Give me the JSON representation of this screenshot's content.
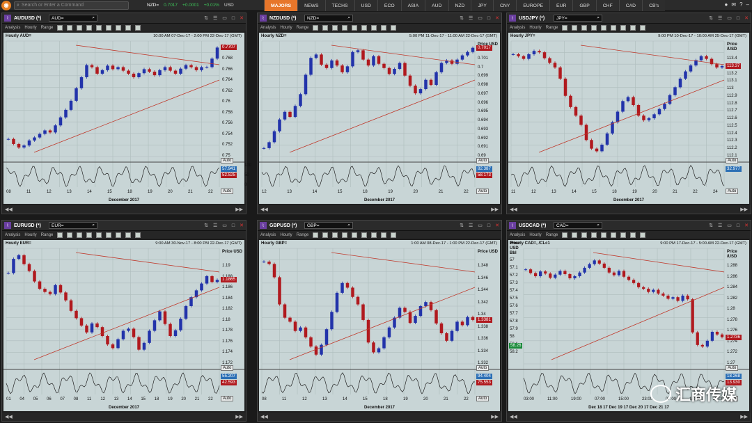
{
  "app": {
    "search_placeholder": "Search or Enter a Command",
    "ticker": {
      "symbol": "NZD=",
      "price": "0.7017",
      "change": "+0.0001",
      "pct": "+0.01%",
      "ccy": "USD"
    },
    "tabs": [
      "MAJORS",
      "NEWS",
      "TECHS",
      "USD",
      "ECO",
      "ASIA",
      "AUD",
      "NZD",
      "JPY",
      "CNY",
      "EUROPE",
      "EUR",
      "GBP",
      "CHF",
      "CAD",
      "CB's"
    ],
    "active_tab": "MAJORS"
  },
  "toolbar": {
    "analysis": "Analysis",
    "interval": "Hourly",
    "range": "Range",
    "auto": "Auto"
  },
  "panels": [
    {
      "title": "AUDUSD (*)",
      "ric": "AUD=",
      "header": "Hourly AUD=",
      "range": "10:00 AM 07-Dec-17 - 2:00 PM 22-Dec-17 (GMT)",
      "yaxis_title": "",
      "yticks": [
        "0.768",
        "0.766",
        "0.764",
        "0.762",
        "0.76",
        "0.758",
        "0.756",
        "0.754",
        "0.752",
        "0.75"
      ],
      "price_badge": "0.7707",
      "price_color": "#b0191e",
      "osc_ticks": [
        "100",
        "50",
        "0"
      ],
      "osc_badges": [
        "57.941",
        "52.525"
      ],
      "xticks": [
        "08",
        "11",
        "12",
        "13",
        "14",
        "15",
        "18",
        "19",
        "20",
        "21",
        "22"
      ],
      "month": "December 2017",
      "chart_data": {
        "type": "line",
        "ylim": [
          0.749,
          0.772
        ],
        "y": [
          0.7525,
          0.7515,
          0.7508,
          0.7512,
          0.7522,
          0.7528,
          0.7535,
          0.7542,
          0.7538,
          0.7552,
          0.7568,
          0.7583,
          0.7601,
          0.7626,
          0.7648,
          0.7672,
          0.7668,
          0.7655,
          0.7662,
          0.7671,
          0.7664,
          0.7668,
          0.7661,
          0.7655,
          0.7648,
          0.7656,
          0.7664,
          0.7659,
          0.7652,
          0.7662,
          0.7668,
          0.7661,
          0.7655,
          0.7665,
          0.7672,
          0.7668,
          0.7662,
          0.7668,
          0.7668,
          0.7685,
          0.7707
        ]
      }
    },
    {
      "title": "NZDUSD (*)",
      "ric": "NZD=",
      "header": "Hourly NZD=",
      "range": "5:00 PM 11-Dec-17 - 11:00 AM 22-Dec-17 (GMT)",
      "yaxis_title": "Price USD",
      "yticks": [
        "0.701",
        "0.7",
        "0.699",
        "0.698",
        "0.697",
        "0.696",
        "0.695",
        "0.694",
        "0.693",
        "0.692",
        "0.691",
        "0.69"
      ],
      "price_badge": "0.7017",
      "price_color": "#b0191e",
      "osc_ticks": [],
      "osc_badges": [
        "82.387",
        "58.173"
      ],
      "xticks": [
        "12",
        "13",
        "14",
        "15",
        "18",
        "19",
        "20",
        "21",
        "22"
      ],
      "month": "December 2017",
      "chart_data": {
        "type": "line",
        "ylim": [
          0.6888,
          0.7025
        ],
        "y": [
          0.6898,
          0.6905,
          0.6918,
          0.6932,
          0.6941,
          0.6935,
          0.6948,
          0.6962,
          0.6985,
          0.7005,
          0.7009,
          0.6997,
          0.6993,
          0.7002,
          0.6996,
          0.6988,
          0.6995,
          0.7012,
          0.7014,
          0.7003,
          0.6996,
          0.7007,
          0.6998,
          0.6993,
          0.6986,
          0.6992,
          0.6999,
          0.6984,
          0.6972,
          0.6963,
          0.6968,
          0.6979,
          0.6973,
          0.6988,
          0.6999,
          0.7002,
          0.6998,
          0.7003,
          0.7008,
          0.7012,
          0.7017
        ]
      }
    },
    {
      "title": "USDJPY (*)",
      "ric": "JPY=",
      "header": "Hourly JPY=",
      "range": "9:00 PM 10-Dec-17 - 10:00 AM 25-Dec-17 (GMT)",
      "yaxis_title": "Price /USD",
      "yticks": [
        "113.4",
        "113.3",
        "113.2",
        "113.1",
        "113",
        "112.9",
        "112.8",
        "112.7",
        "112.6",
        "112.5",
        "112.4",
        "112.3",
        "112.2",
        "112.1"
      ],
      "price_badge": "113.37",
      "price_color": "#b0191e",
      "osc_ticks": [],
      "osc_badges": [
        "32.977"
      ],
      "xticks": [
        "11",
        "12",
        "13",
        "14",
        "15",
        "18",
        "19",
        "20",
        "21",
        "22",
        "24"
      ],
      "month": "December 2017",
      "chart_data": {
        "type": "line",
        "ylim": [
          112.0,
          113.75
        ],
        "y": [
          113.55,
          113.52,
          113.48,
          113.55,
          113.6,
          113.58,
          113.49,
          113.42,
          113.35,
          113.18,
          112.92,
          112.75,
          112.62,
          112.48,
          112.25,
          112.12,
          112.08,
          112.18,
          112.35,
          112.52,
          112.68,
          112.84,
          112.9,
          112.78,
          112.62,
          112.55,
          112.58,
          112.64,
          112.72,
          112.8,
          112.93,
          113.05,
          113.18,
          113.29,
          113.38,
          113.46,
          113.52,
          113.48,
          113.4,
          113.35,
          113.37
        ]
      }
    },
    {
      "title": "EURUSD (*)",
      "ric": "EUR=",
      "header": "Hourly EUR=",
      "range": "9:00 AM 30-Nov-17 - 8:00 PM 22-Dec-17 (GMT)",
      "yaxis_title": "Price USD",
      "yticks": [
        "1.19",
        "1.188",
        "1.186",
        "1.184",
        "1.182",
        "1.18",
        "1.178",
        "1.176",
        "1.174",
        "1.172"
      ],
      "price_badge": "1.1865",
      "price_color": "#b0191e",
      "osc_ticks": [],
      "osc_badges": [
        "55.207",
        "42.593"
      ],
      "xticks": [
        "01",
        "04",
        "05",
        "06",
        "07",
        "08",
        "11",
        "12",
        "13",
        "14",
        "15",
        "18",
        "19",
        "20",
        "21",
        "22"
      ],
      "month": "December 2017",
      "chart_data": {
        "type": "line",
        "ylim": [
          1.1705,
          1.1925
        ],
        "y": [
          1.1878,
          1.1905,
          1.1912,
          1.1895,
          1.1882,
          1.1862,
          1.1848,
          1.1842,
          1.1838,
          1.1855,
          1.1841,
          1.1826,
          1.1806,
          1.1792,
          1.1778,
          1.1765,
          1.1782,
          1.1775,
          1.1758,
          1.1742,
          1.1735,
          1.1752,
          1.1768,
          1.1772,
          1.1756,
          1.1732,
          1.1745,
          1.1768,
          1.1788,
          1.1805,
          1.1781,
          1.1758,
          1.1769,
          1.1791,
          1.1815,
          1.1832,
          1.1845,
          1.1858,
          1.1872,
          1.1861,
          1.1865
        ]
      }
    },
    {
      "title": "GBPUSD (*)",
      "ric": "GBP=",
      "header": "Hourly GBP=",
      "range": "1:00 AM 08-Dec-17 - 1:00 PM 22-Dec-17 (GMT)",
      "yaxis_title": "Price USD",
      "yticks": [
        "1.348",
        "1.346",
        "1.344",
        "1.342",
        "1.34",
        "1.338",
        "1.336",
        "1.334",
        "1.332"
      ],
      "price_badge": "1.3381",
      "price_color": "#b0191e",
      "osc_ticks": [],
      "osc_badges": [
        "94.404",
        "75.553"
      ],
      "xticks": [
        "08",
        "11",
        "12",
        "13",
        "14",
        "15",
        "18",
        "19",
        "20",
        "21",
        "22"
      ],
      "month": "December 2017",
      "chart_data": {
        "type": "line",
        "ylim": [
          1.3305,
          1.3505
        ],
        "y": [
          1.3482,
          1.3478,
          1.3455,
          1.3408,
          1.3385,
          1.3378,
          1.3362,
          1.3368,
          1.3351,
          1.3335,
          1.3321,
          1.3338,
          1.3365,
          1.3395,
          1.3428,
          1.3445,
          1.3437,
          1.3421,
          1.3408,
          1.3381,
          1.3342,
          1.3325,
          1.3332,
          1.3351,
          1.3368,
          1.3385,
          1.3402,
          1.3395,
          1.3376,
          1.3388,
          1.3405,
          1.3412,
          1.3398,
          1.3375,
          1.3358,
          1.3345,
          1.3362,
          1.3378,
          1.3372,
          1.3386,
          1.3381
        ]
      }
    },
    {
      "title": "USDCAD (*)",
      "ric": "CAD=",
      "header": "Hourly CAD=, /CLc1",
      "range": "9:00 PM 17-Dec-17 - 5:00 AM 22-Dec-17 (GMT)",
      "yaxis_title": "Price /USD",
      "yticks": [
        "1.288",
        "1.286",
        "1.284",
        "1.282",
        "1.28",
        "1.278",
        "1.276",
        "1.274",
        "1.272",
        "1.27"
      ],
      "left_title": "Price USD Bbl",
      "left_ticks": [
        "57",
        "57.1",
        "57.2",
        "57.3",
        "57.4",
        "57.5",
        "57.6",
        "57.7",
        "57.8",
        "57.9",
        "58",
        "58.1",
        "58.2"
      ],
      "price_badge": "1.2736",
      "price_color": "#b0191e",
      "left_badge": "58.26",
      "osc_ticks": [],
      "osc_badges": [
        "18.268",
        "13.930"
      ],
      "xticks": [
        "03:00",
        "11:00",
        "19:00",
        "07:00",
        "15:00",
        "23:00",
        "07:00",
        "15:00",
        "23:00"
      ],
      "month": "Dec 18 17     Dec 19 17     Dec 20 17     Dec 21 17",
      "chart_data": {
        "type": "line",
        "ylim": [
          1.2685,
          1.2905
        ],
        "y": [
          1.2865,
          1.2858,
          1.2852,
          1.2861,
          1.2857,
          1.2849,
          1.2855,
          1.2862,
          1.2856,
          1.2848,
          1.2852,
          1.2859,
          1.2868,
          1.2875,
          1.2882,
          1.2876,
          1.2868,
          1.2859,
          1.2854,
          1.2862,
          1.2851,
          1.2845,
          1.2839,
          1.2831,
          1.2828,
          1.2822,
          1.2826,
          1.2819,
          1.2815,
          1.2809,
          1.2812,
          1.2805,
          1.2815,
          1.2808,
          1.2745,
          1.2721,
          1.2718,
          1.2729,
          1.2746,
          1.2741,
          1.2736
        ]
      }
    }
  ],
  "watermark": "汇商传媒"
}
